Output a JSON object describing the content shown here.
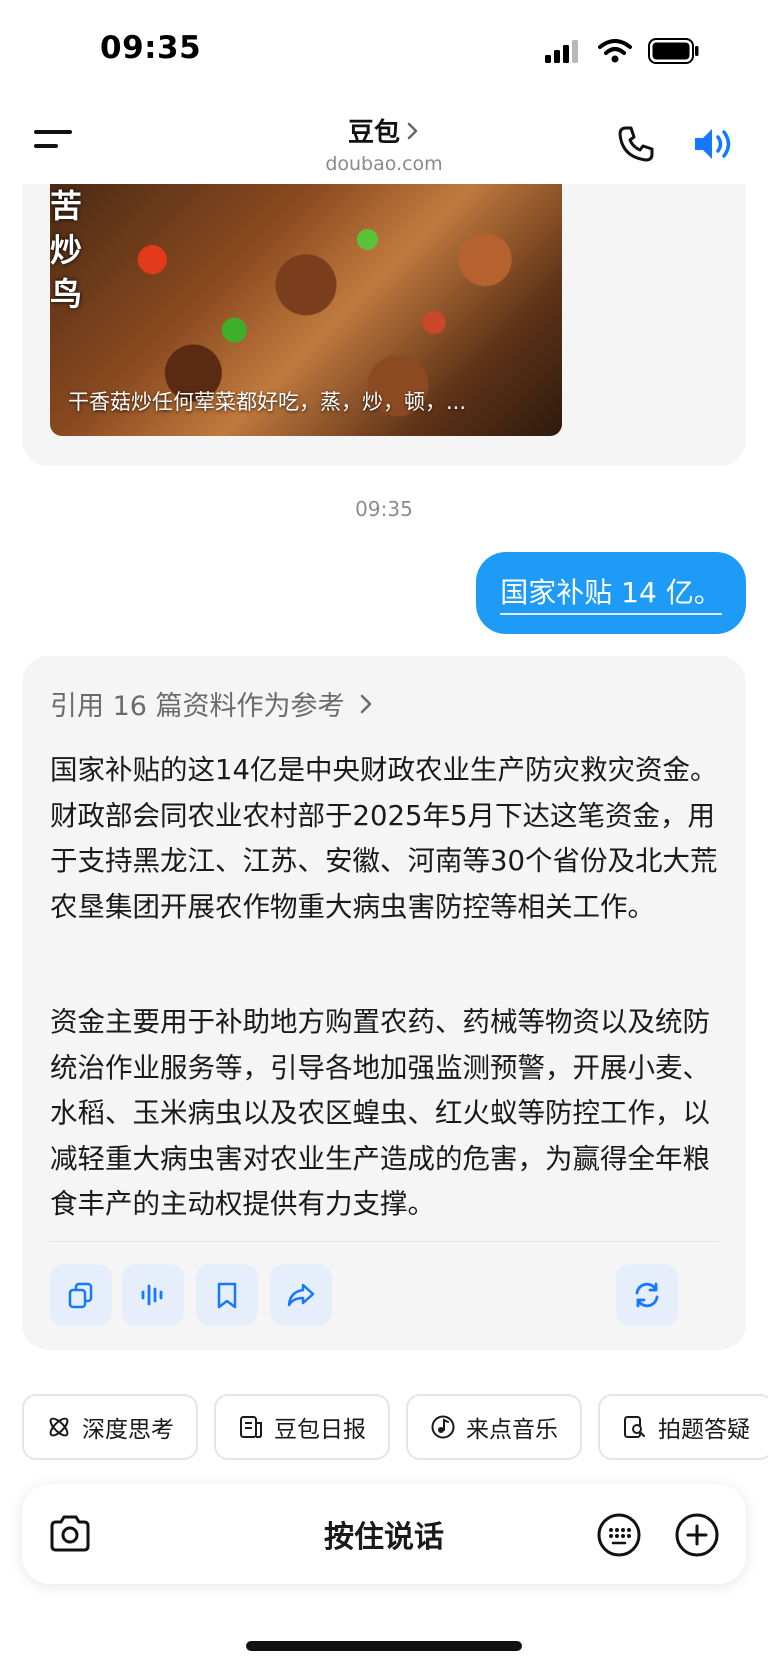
{
  "status_bar": {
    "time": "09:35"
  },
  "header": {
    "title": "豆包",
    "subtitle": "doubao.com"
  },
  "prev_message": {
    "video_side_text": "苦\n炒\n鸟",
    "video_caption": "干香菇炒任何荤菜都好吃，蒸，炒，顿，..."
  },
  "timestamp": "09:35",
  "user_message": "国家补贴 14 亿。",
  "ai_reply": {
    "reference": "引用 16 篇资料作为参考",
    "paragraphs": [
      "国家补贴的这14亿是中央财政农业生产防灾救灾资金。财政部会同农业农村部于2025年5月下达这笔资金，用于支持黑龙江、江苏、安徽、河南等30个省份及北大荒农垦集团开展农作物重大病虫害防控等相关工作。",
      "资金主要用于补助地方购置农药、药械等物资以及统防统治作业服务等，引导各地加强监测预警，开展小麦、水稻、玉米病虫以及农区蝗虫、红火蚁等防控工作，以减轻重大病虫害对农业生产造成的危害，为赢得全年粮食丰产的主动权提供有力支撑。"
    ]
  },
  "quick_actions": [
    {
      "label": "深度思考",
      "icon": "atom-icon"
    },
    {
      "label": "豆包日报",
      "icon": "newspaper-icon"
    },
    {
      "label": "来点音乐",
      "icon": "music-icon"
    },
    {
      "label": "拍题答疑",
      "icon": "search-doc-icon"
    }
  ],
  "input_bar": {
    "hold_to_talk": "按住说话"
  },
  "colors": {
    "accent": "#1d9bf6",
    "icon_blue": "#1677ff",
    "card_bg": "#f5f5f6"
  }
}
